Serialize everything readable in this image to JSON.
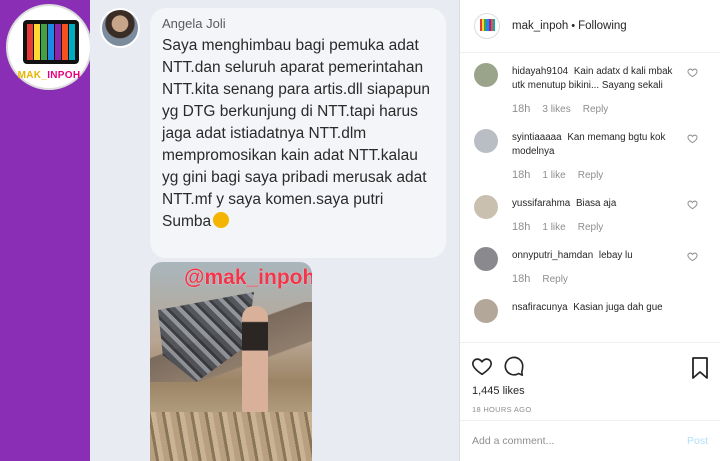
{
  "post_image": {
    "logo_text_a": "MAK_",
    "logo_text_b": "INPOH",
    "tv_colors": [
      "#e53935",
      "#fdd835",
      "#43a047",
      "#1e88e5",
      "#8e24aa",
      "#f4511e",
      "#00acc1"
    ],
    "commenter_name": "Angela Joli",
    "comment_text": "Saya menghimbau bagi pemuka adat NTT.dan seluruh aparat pemerintahan NTT.kita senang para artis.dll siapapun yg DTG berkunjung di NTT.tapi harus jaga adat istiadatnya NTT.dlm mempromosikan kain adat NTT.kalau yg gini bagi saya pribadi merusak adat NTT.mf y saya komen.saya putri Sumba",
    "watermark": "@mak_inpoh"
  },
  "header": {
    "username": "mak_inpoh",
    "separator": "•",
    "follow_status": "Following"
  },
  "comments": [
    {
      "user": "hidayah9104",
      "text": "Kain adatx d kali mbak utk menutup bikini... Sayang sekali",
      "time": "18h",
      "likes": "3 likes",
      "reply": "Reply",
      "avatar_color": "#9aa48a"
    },
    {
      "user": "syintiaaaaa",
      "text": "Kan memang bgtu kok modelnya",
      "time": "18h",
      "likes": "1 like",
      "reply": "Reply",
      "avatar_color": "#b9bdc4"
    },
    {
      "user": "yussifarahma",
      "text": "Biasa aja",
      "time": "18h",
      "likes": "1 like",
      "reply": "Reply",
      "avatar_color": "#c9c0b0"
    },
    {
      "user": "onnyputri_hamdan",
      "text": "lebay lu",
      "time": "18h",
      "likes": "",
      "reply": "Reply",
      "avatar_color": "#8a8a8e"
    },
    {
      "user": "nsafiracunya",
      "text": "Kasian juga dah gue",
      "time": "",
      "likes": "",
      "reply": "",
      "avatar_color": "#b3a79a"
    }
  ],
  "actions": {
    "likes": "1,445 likes",
    "timestamp": "18 HOURS AGO"
  },
  "add_comment": {
    "placeholder": "Add a comment...",
    "post_label": "Post"
  },
  "colors": {
    "purple_band": "#8a2fb5",
    "watermark": "#f2354a",
    "link_disabled": "#b2dffc"
  }
}
